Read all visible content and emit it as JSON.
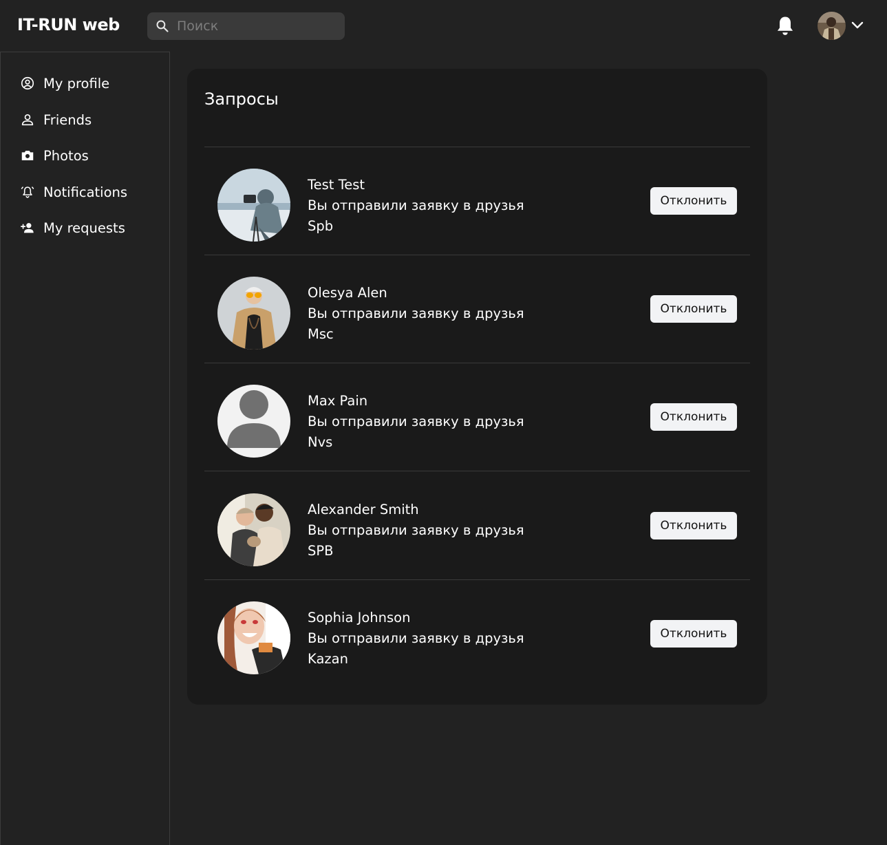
{
  "header": {
    "logo": "IT-RUN web",
    "search_placeholder": "Поиск"
  },
  "sidebar": {
    "items": [
      {
        "label": "My profile",
        "icon": "user-circle-icon"
      },
      {
        "label": "Friends",
        "icon": "users-icon"
      },
      {
        "label": "Photos",
        "icon": "camera-icon"
      },
      {
        "label": "Notifications",
        "icon": "bell-ring-icon"
      },
      {
        "label": "My requests",
        "icon": "user-plus-icon"
      }
    ]
  },
  "main": {
    "title": "Запросы",
    "requests": [
      {
        "name": "Test Test",
        "message": "Вы отправили заявку в друзья",
        "city": "Spb",
        "button": "Отклонить"
      },
      {
        "name": "Olesya Alen",
        "message": "Вы отправили заявку в друзья",
        "city": "Msc",
        "button": "Отклонить"
      },
      {
        "name": "Max Pain",
        "message": "Вы отправили заявку в друзья",
        "city": "Nvs",
        "button": "Отклонить"
      },
      {
        "name": "Alexander Smith",
        "message": "Вы отправили заявку в друзья",
        "city": "SPB",
        "button": "Отклонить"
      },
      {
        "name": "Sophia Johnson",
        "message": "Вы отправили заявку в друзья",
        "city": "Kazan",
        "button": "Отклонить"
      }
    ]
  }
}
